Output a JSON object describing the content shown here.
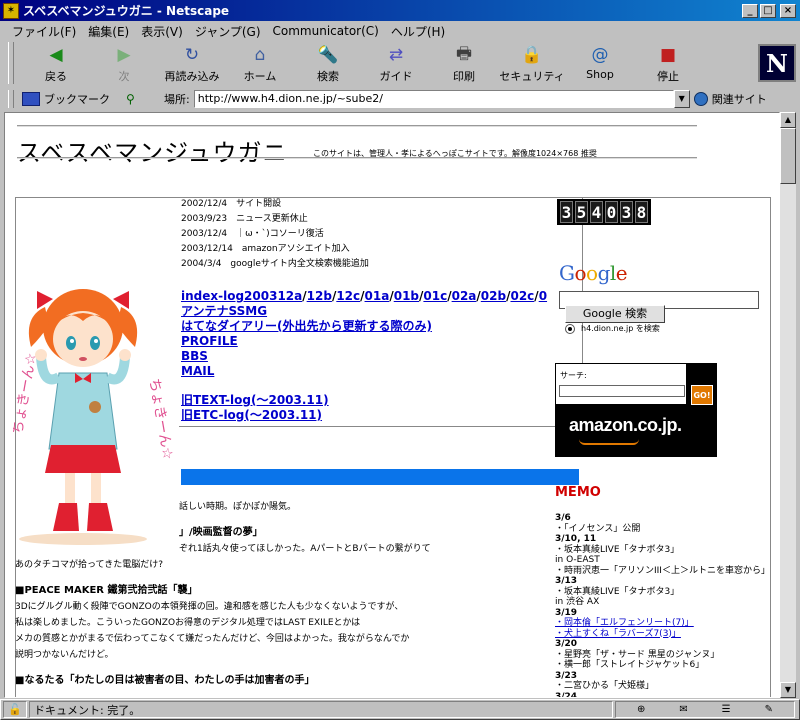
{
  "window": {
    "title": "スベスベマンジュウガニ - Netscape",
    "controls": [
      "_",
      "□",
      "×"
    ]
  },
  "menu": [
    "ファイル(F)",
    "編集(E)",
    "表示(V)",
    "ジャンプ(G)",
    "Communicator(C)",
    "ヘルプ(H)"
  ],
  "toolbar": [
    {
      "label": "戻る",
      "icon": "back-arrow-icon",
      "glyph": "◀"
    },
    {
      "label": "次",
      "icon": "forward-arrow-icon",
      "glyph": "▶"
    },
    {
      "label": "再読み込み",
      "icon": "reload-icon",
      "glyph": "↻"
    },
    {
      "label": "ホーム",
      "icon": "home-icon",
      "glyph": "⌂"
    },
    {
      "label": "検索",
      "icon": "search-icon",
      "glyph": "🔦"
    },
    {
      "label": "ガイド",
      "icon": "guide-icon",
      "glyph": "⇄"
    },
    {
      "label": "印刷",
      "icon": "print-icon",
      "glyph": "🖶"
    },
    {
      "label": "セキュリティ",
      "icon": "security-lock-icon",
      "glyph": "🔒"
    },
    {
      "label": "Shop",
      "icon": "shop-icon",
      "glyph": "@"
    },
    {
      "label": "停止",
      "icon": "stop-icon",
      "glyph": "■"
    }
  ],
  "brand_logo": "N",
  "location": {
    "bookmarks_label": "ブックマーク",
    "location_label": "場所:",
    "url": "http://www.h4.dion.ne.jp/~sube2/",
    "related_label": "関連サイト"
  },
  "status": {
    "message": "ドキュメント: 完了。"
  },
  "page": {
    "title": "スベスベマンジュウガニ",
    "subtitle": "このサイトは、管理人・孝によるへっぽこサイトです。解像度1024×768 推奨",
    "history": [
      "2002/12/4　サイト開設",
      "2003/9/23　ニュース更新休止",
      "2003/12/4　｜ω・`)コソーリ復活",
      "2003/12/14　amazonアソシエイト加入",
      "2004/3/4　googleサイト内全文検索機能追加"
    ],
    "log_links": [
      "index-log200312a",
      "12b",
      "12c",
      "01a",
      "01b",
      "01c",
      "02a",
      "02b",
      "02c",
      "0"
    ],
    "links": {
      "antenna": "アンテナSSMG",
      "hatena": "はてなダイアリー(外出先から更新する際のみ)",
      "profile": "PROFILE",
      "bbs": "BBS",
      "mail": "MAIL",
      "old_text": "旧TEXT-log(〜2003.11)",
      "old_etc": "旧ETC-log(〜2003.11)"
    },
    "news": [
      {
        "text": "話しい時期。ぽかぽか陽気。",
        "bold": false
      },
      {
        "text": "",
        "bold": false
      },
      {
        "text": "」/映画監督の夢」",
        "bold": true
      },
      {
        "text": "ぞれ1話丸々使ってほしかった。AパートとBパートの繋がりて",
        "bold": false
      },
      {
        "text": "あのタチコマが拾ってきた電脳だけ?",
        "bold": false
      },
      {
        "text": "",
        "bold": false
      },
      {
        "text": "■PEACE MAKER 鐵第弐拾弐話「襲」",
        "bold": true
      },
      {
        "text": "3Dにグルグル動く殺陣でGONZOの本領発揮の回。違和感を感じた人も少なくないようですが、",
        "bold": false
      },
      {
        "text": "私は楽しめました。こういったGONZOお得意のデジタル処理ではLAST EXILEとかは",
        "bold": false
      },
      {
        "text": "メカの質感とかがまるで伝わってこなくて嫌だったんだけど、今回はよかった。我ながらなんでか",
        "bold": false
      },
      {
        "text": "説明つかないんだけど。",
        "bold": false
      },
      {
        "text": "",
        "bold": false
      },
      {
        "text": "■なるたる「わたしの目は被害者の目、わたしの手は加害者の手」",
        "bold": true
      }
    ]
  },
  "counter": "354038",
  "google": {
    "logo": "Google",
    "button": "Google 検索",
    "radio_label": "h4.dion.ne.jp を検索"
  },
  "amazon": {
    "search_label": "サーチ:",
    "go": "GO!",
    "logo": "amazon.co.jp."
  },
  "memo": {
    "title": "MEMO",
    "lines": [
      {
        "t": "3/6",
        "d": true
      },
      {
        "t": "・「イノセンス」公開",
        "d": false
      },
      {
        "t": "3/10, 11",
        "d": true
      },
      {
        "t": "・坂本真綾LIVE「タナボタ3」",
        "d": false
      },
      {
        "t": "in O-EAST",
        "d": false
      },
      {
        "t": "・時雨沢恵一「アリソンIII＜上＞ルトニを車窓から」",
        "d": false
      },
      {
        "t": "3/13",
        "d": true
      },
      {
        "t": "・坂本真綾LIVE「タナボタ3」",
        "d": false
      },
      {
        "t": "in 渋谷 AX",
        "d": false
      },
      {
        "t": "3/19",
        "d": true
      },
      {
        "t": "・岡本倫「エルフェンリート(7)」",
        "d": false,
        "link": true
      },
      {
        "t": "・犬上すくね「ラバーズ7(3)」",
        "d": false,
        "link": true
      },
      {
        "t": "3/20",
        "d": true
      },
      {
        "t": "・星野亮「ザ・サード 黒星のジャンヌ」",
        "d": false
      },
      {
        "t": "・横一郎「ストレイトジャケット6」",
        "d": false
      },
      {
        "t": "3/23",
        "d": true
      },
      {
        "t": "・二宮ひかる「犬姫様」",
        "d": false
      },
      {
        "t": "3/24",
        "d": true
      }
    ]
  }
}
